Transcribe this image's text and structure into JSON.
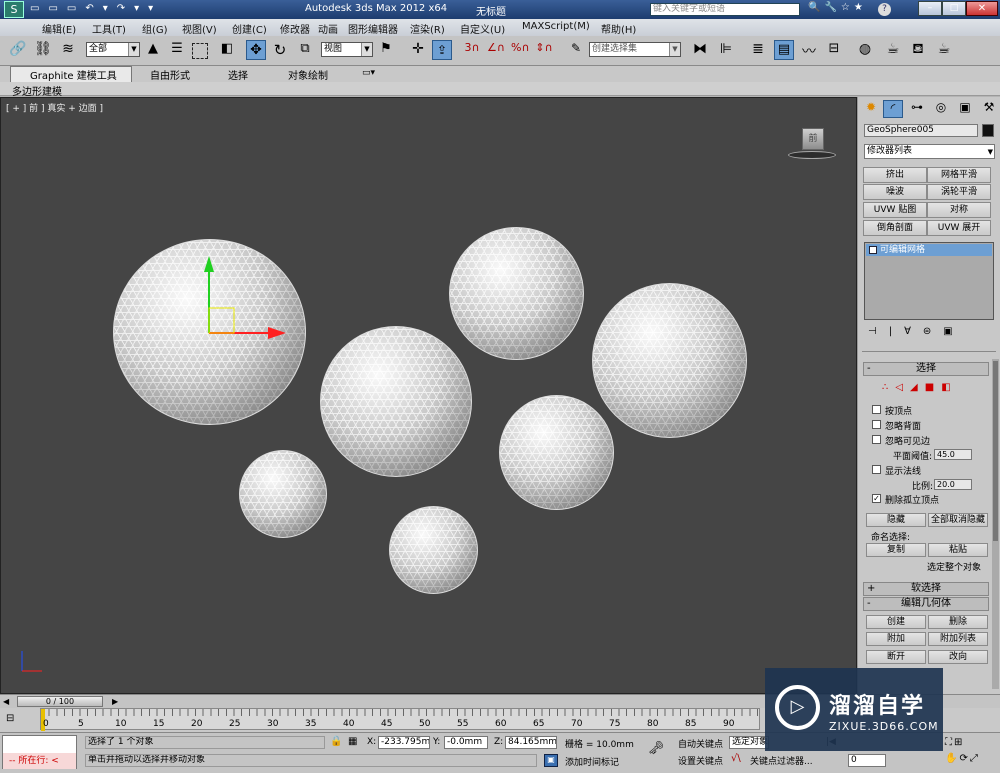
{
  "titlebar": {
    "app_title": "Autodesk 3ds Max  2012 x64",
    "doc_title": "无标题",
    "search_placeholder": "键入关键字或短语"
  },
  "menu": [
    "编辑(E)",
    "工具(T)",
    "组(G)",
    "视图(V)",
    "创建(C)",
    "修改器",
    "动画",
    "图形编辑器",
    "渲染(R)",
    "自定义(U)",
    "MAXScript(M)",
    "帮助(H)"
  ],
  "toolbar": {
    "selection_filter": "全部",
    "ref_coord": "视图",
    "named_selection_placeholder": "创建选择集"
  },
  "ribbon": {
    "tabs": [
      "Graphite 建模工具",
      "自由形式",
      "选择",
      "对象绘制"
    ],
    "sub_label": "多边形建模"
  },
  "viewport": {
    "label": "[ + ] 前 ] 真实 + 边面 ]",
    "viewcube_label": "前"
  },
  "command_panel": {
    "object_name": "GeoSphere005",
    "modifier_list": "修改器列表",
    "mod_buttons": [
      "挤出",
      "网格平滑",
      "噪波",
      "涡轮平滑",
      "UVW 贴图",
      "对称",
      "倒角剖面",
      "UVW 展开"
    ],
    "stack_item": "可编辑网格",
    "selection_rollout": "选择",
    "by_vertex": "按顶点",
    "ignore_backface": "忽略背面",
    "ignore_visible_edges": "忽略可见边",
    "planar_thresh_label": "平面阈值:",
    "planar_thresh_value": "45.0",
    "show_normals": "显示法线",
    "scale_label": "比例:",
    "scale_value": "20.0",
    "delete_isolated": "删除孤立顶点",
    "hide": "隐藏",
    "unhide_all": "全部取消隐藏",
    "named_sel_label": "命名选择:",
    "copy": "复制",
    "paste": "粘贴",
    "select_open_edges": "选定整个对象",
    "soft_selection": "软选择",
    "edit_geometry": "编辑几何体",
    "create": "创建",
    "delete": "删除",
    "attach": "附加",
    "attach_list": "附加列表",
    "detach": "断开",
    "change": "改向"
  },
  "timeline": {
    "frame": "0 / 100",
    "ticks": [
      "0",
      "5",
      "10",
      "15",
      "20",
      "25",
      "30",
      "35",
      "40",
      "45",
      "50",
      "55",
      "60",
      "65",
      "70",
      "75",
      "80",
      "85",
      "90"
    ]
  },
  "status": {
    "maxscript_label": "所在行:",
    "selection_msg": "选择了 1 个对象",
    "prompt_msg": "单击并拖动以选择并移动对象",
    "x_label": "X:",
    "x_value": "-233.795m",
    "y_label": "Y:",
    "y_value": "-0.0mm",
    "z_label": "Z:",
    "z_value": "84.165mm",
    "grid": "栅格 = 10.0mm",
    "add_time_tag": "添加时间标记",
    "auto_key": "自动关键点",
    "selected_obj": "选定对象",
    "set_key": "设置关键点",
    "key_filters": "关键点过滤器...",
    "frame_value": "0"
  },
  "watermark": {
    "brand": "溜溜自学",
    "url": "ZIXUE.3D66.COM"
  },
  "colors": {
    "viewport_bg": "#454545",
    "accent": "#3a5f98",
    "axis_x": "#ff2020",
    "axis_y": "#20d020",
    "axis_z": "#2050ff"
  }
}
